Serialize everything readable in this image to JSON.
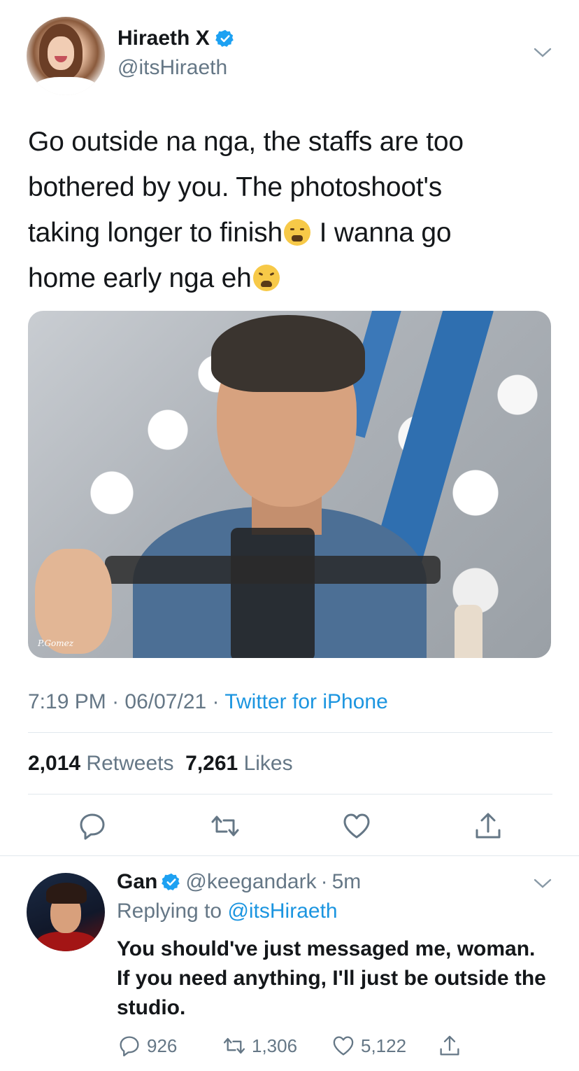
{
  "tweet": {
    "author": {
      "display_name": "Hiraeth X",
      "handle": "@itsHiraeth",
      "verified": true,
      "avatar": "avatar-photo"
    },
    "text": {
      "line1": "Go outside na nga, the staffs are too",
      "line2": "bothered by you. The photoshoot's",
      "line3": "taking longer to finish",
      "line3b": " I wanna go",
      "line4": "home early nga eh",
      "emoji_1": "face-with-steam-icon",
      "emoji_2": "tired-face-icon"
    },
    "media": {
      "watermark": "P.Gomez"
    },
    "time": "7:19 PM",
    "date": "06/07/21",
    "source": "Twitter for iPhone",
    "retweets_count": "2,014",
    "retweets_label": "Retweets",
    "likes_count": "7,261",
    "likes_label": "Likes",
    "actions": [
      "reply-icon",
      "retweet-icon",
      "like-icon",
      "share-icon"
    ]
  },
  "reply": {
    "author": {
      "display_name": "Gan",
      "handle": "@keegandark",
      "verified": true
    },
    "age": "5m",
    "replying_prefix": "Replying to",
    "replying_to": "@itsHiraeth",
    "text": "You should've just messaged me, woman. If you need anything, I'll just be outside the studio.",
    "reply_count": "926",
    "retweet_count": "1,306",
    "like_count": "5,122"
  },
  "colors": {
    "link": "#1b95e0",
    "verified": "#1da1f2",
    "secondary_text": "#657786",
    "primary_text": "#14171a",
    "divider": "#e1e8ed"
  }
}
